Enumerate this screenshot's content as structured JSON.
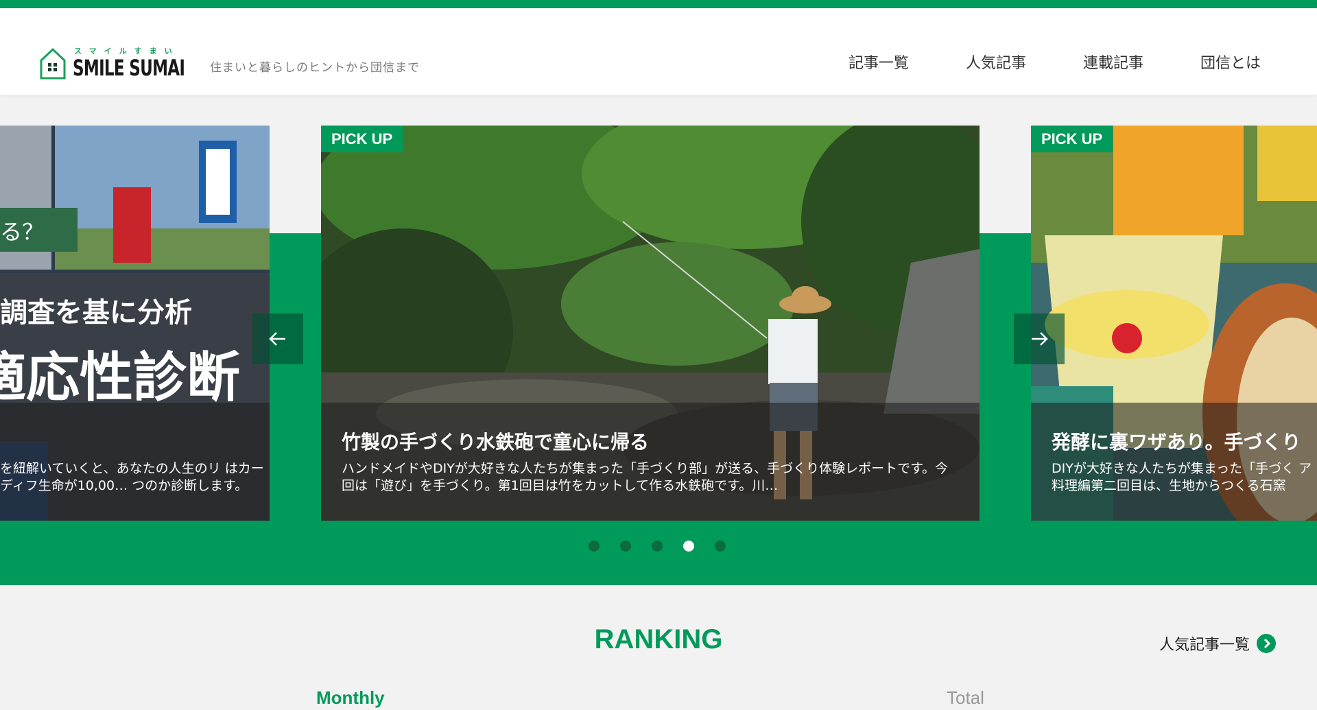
{
  "header": {
    "logo_ruby": "スマイルすまい",
    "logo_text": "SMILE SUMAI",
    "tagline": "住まいと暮らしのヒントから団信まで",
    "nav": [
      "記事一覧",
      "人気記事",
      "連載記事",
      "団信とは"
    ]
  },
  "carousel": {
    "left_slide": {
      "badge": "る？",
      "line1": "調査を基に分析",
      "line2": "適応性診断",
      "desc": "を紐解いていくと、あなたの人生のリ はカーディフ生命が10,00… つのか診断します。"
    },
    "center_slide": {
      "badge": "PICK UP",
      "title": "竹製の手づくり水鉄砲で童心に帰る",
      "desc": "ハンドメイドやDIYが大好きな人たちが集まった「手づくり部」が送る、手づくり体験レポートです。今回は「遊び」を手づくり。第1回目は竹をカットして作る水鉄砲です。川…"
    },
    "right_slide": {
      "badge": "PICK UP",
      "title": "発酵に裏ワザあり。手づくり",
      "desc": "DIYが大好きな人たちが集まった「手づく ア料理編第二回目は、生地からつくる石窯"
    },
    "dots_count": 5,
    "active_dot": 4
  },
  "ranking": {
    "title": "RANKING",
    "popular_link": "人気記事一覧",
    "tabs": [
      "Monthly",
      "Total"
    ]
  },
  "colors": {
    "brand_green": "#009a5a"
  }
}
